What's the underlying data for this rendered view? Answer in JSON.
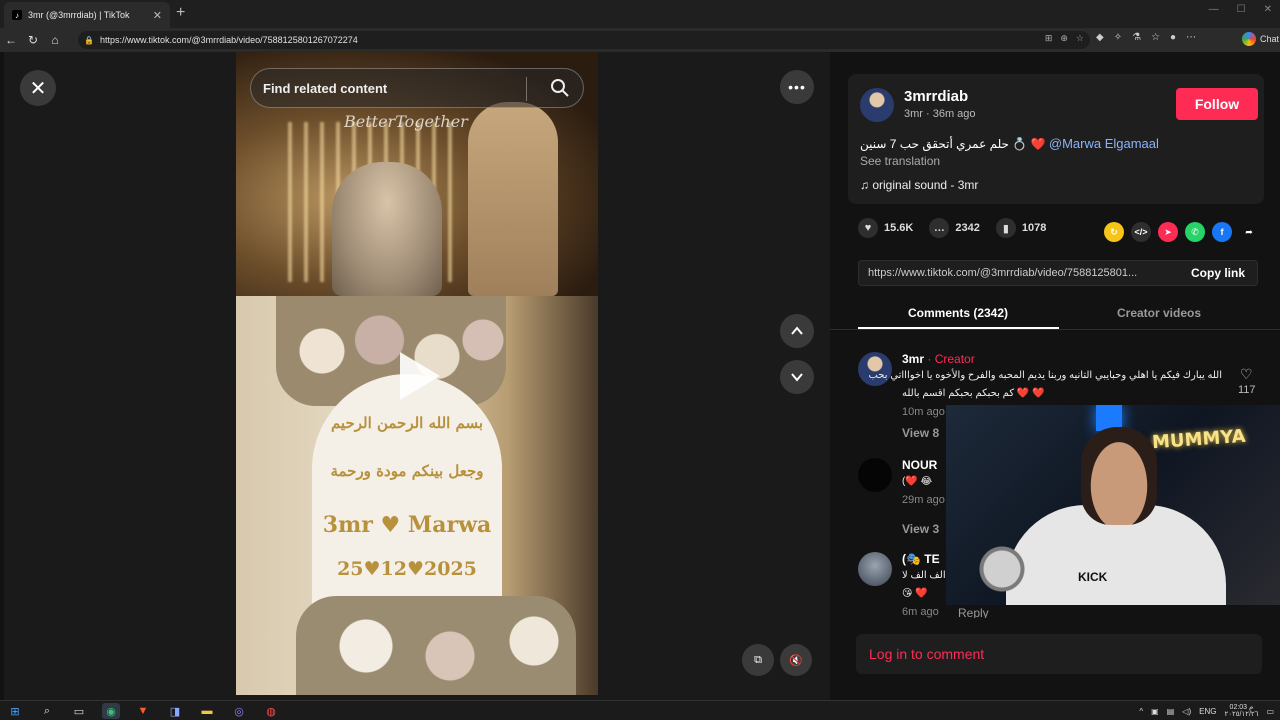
{
  "browser": {
    "tab_title": "3mr (@3mrrdiab) | TikTok",
    "url": "https://www.tiktok.com/@3mrrdiab/video/7588125801267072274",
    "chat_label": "Chat"
  },
  "video": {
    "search_placeholder": "Find related content",
    "script_overlay": "BetterTogether",
    "sign_line1": "بسم الله الرحمن الرحيم",
    "sign_line2": "وجعل بينكم مودة ورحمة",
    "sign_names": "3mr ♥ Marwa",
    "sign_date": "25♥12♥2025"
  },
  "post": {
    "username": "3mrrdiab",
    "meta": "3mr · 36m ago",
    "follow_label": "Follow",
    "caption": "حلم عمري أتحقق حب 7 سنين 💍 ❤️",
    "mention": "@Marwa Elgamaal",
    "see_translation": "See translation",
    "sound": "original sound - 3mr",
    "likes": "15.6K",
    "comments_count": "2342",
    "saves": "1078",
    "link": "https://www.tiktok.com/@3mrrdiab/video/7588125801...",
    "copy_link": "Copy link"
  },
  "tabs": {
    "comments": "Comments (2342)",
    "creator_videos": "Creator videos"
  },
  "comments": [
    {
      "name": "3mr",
      "badge": "· Creator",
      "text1": "الله يبارك فيكم يا اهلي وحبايبي التانيه وربنا يديم المحبه والفرح والأخوه يا اخواااتي بحب",
      "text2": "كم بحبكم بحبكم اقسم بالله ❤️ ❤️",
      "time": "10m ago",
      "view": "View 8",
      "likes": "117"
    },
    {
      "name": "NOUR",
      "text1": "(❤️ 😂",
      "time": "29m ago",
      "view": "View 3"
    },
    {
      "name": "(🎭 TE",
      "text1": "الف الف لا",
      "text2": "😘 ❤️",
      "time": "6m ago",
      "reply": "Reply"
    }
  ],
  "login_label": "Log in to comment",
  "webcam": {
    "neon_sign": "MUMMYA",
    "hoodie_text": "KICK"
  },
  "taskbar": {
    "lang": "ENG",
    "time": "02:03 م",
    "date": "٢٠٢٥/١٢/٢٦"
  },
  "colors": {
    "accent": "#fe2c55",
    "mention": "#8ab4f8",
    "panel": "#1e1e1e",
    "background": "#121212"
  }
}
